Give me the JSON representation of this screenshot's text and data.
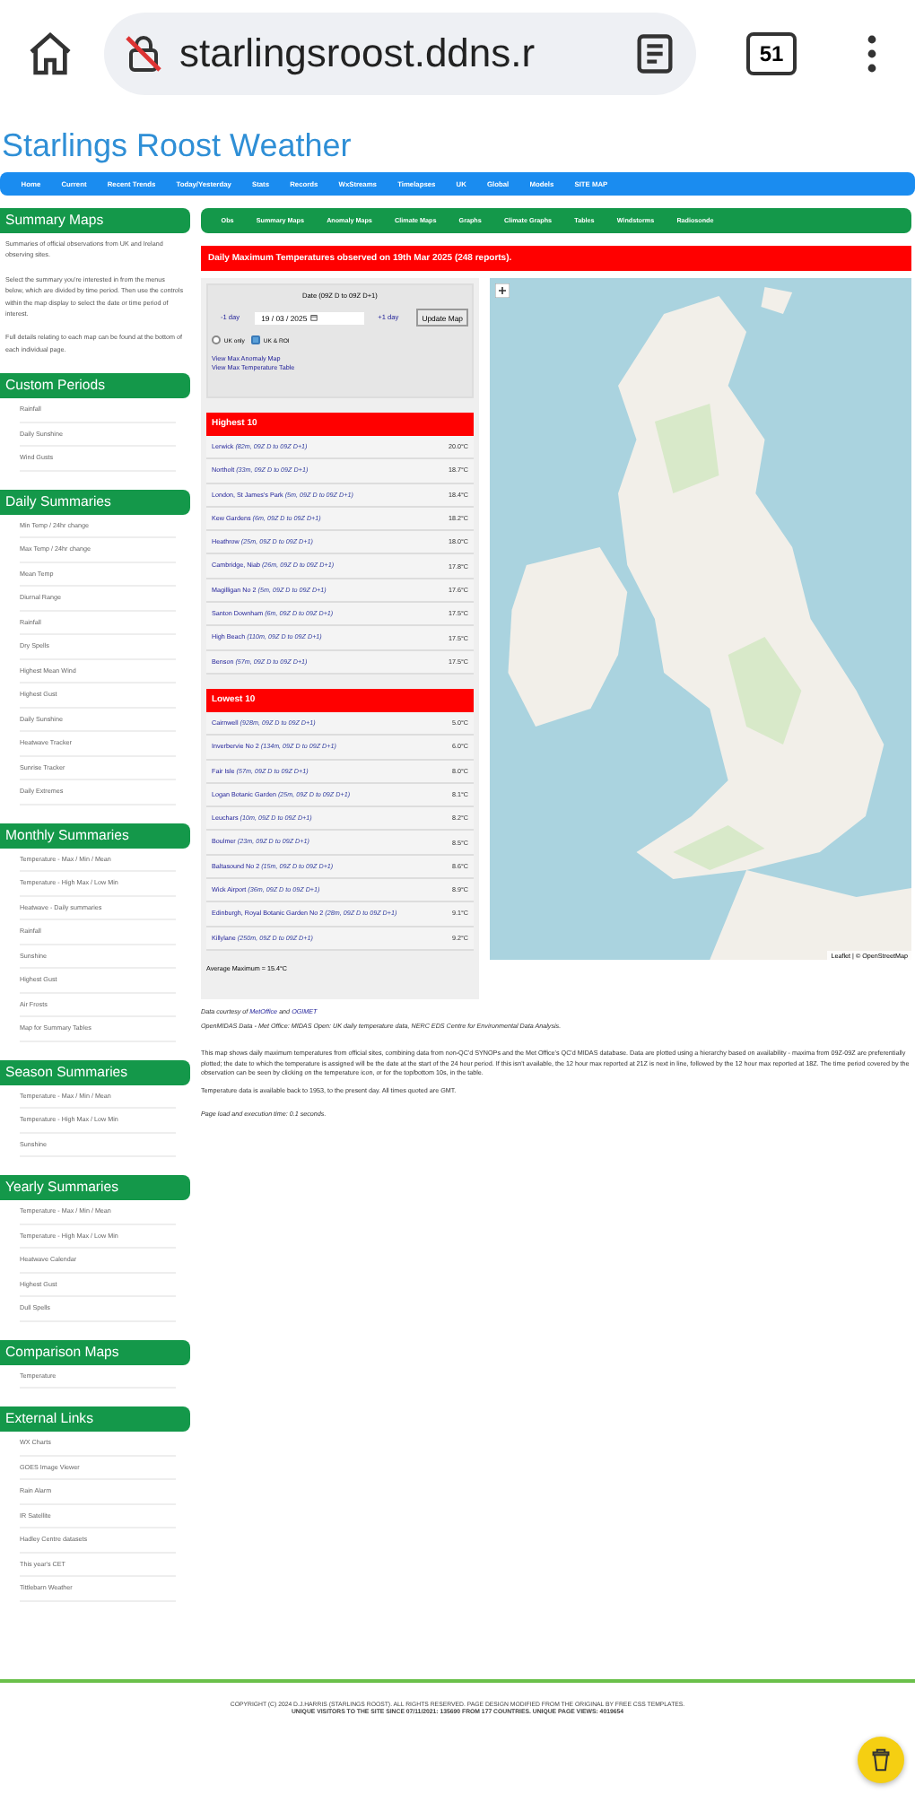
{
  "browser": {
    "url": "starlingsroost.ddns.r",
    "tab_count": "51"
  },
  "site_title": "Starlings Roost Weather",
  "nav": [
    "Home",
    "Current",
    "Recent Trends",
    "Today/Yesterday",
    "Stats",
    "Records",
    "WxStreams",
    "Timelapses",
    "UK",
    "Global",
    "Models",
    "SITE MAP"
  ],
  "sidebar": [
    {
      "title": "Summary Maps",
      "paragraphs": [
        "Summaries of official observations from UK and Ireland observing sites.",
        "Select the summary you're interested in from the menus below, which are divided by time period. Then use the controls within the map display to select the date or time period of interest.",
        "Full details relating to each map can be found at the bottom of each individual page."
      ]
    },
    {
      "title": "Custom Periods",
      "items": [
        "Rainfall",
        "Daily Sunshine",
        "Wind Gusts"
      ]
    },
    {
      "title": "Daily Summaries",
      "items": [
        "Min Temp / 24hr change",
        "Max Temp / 24hr change",
        "Mean Temp",
        "Diurnal Range",
        "Rainfall",
        "Dry Spells",
        "Highest Mean Wind",
        "Highest Gust",
        "Daily Sunshine",
        "Heatwave Tracker",
        "Sunrise Tracker",
        "Daily Extremes"
      ]
    },
    {
      "title": "Monthly Summaries",
      "items": [
        "Temperature - Max / Min / Mean",
        "Temperature - High Max / Low Min",
        "Heatwave - Daily summaries",
        "Rainfall",
        "Sunshine",
        "Highest Gust",
        "Air Frosts",
        "Map for Summary Tables"
      ]
    },
    {
      "title": "Season Summaries",
      "items": [
        "Temperature - Max / Min / Mean",
        "Temperature - High Max / Low Min",
        "Sunshine"
      ]
    },
    {
      "title": "Yearly Summaries",
      "items": [
        "Temperature - Max / Min / Mean",
        "Temperature - High Max / Low Min",
        "Heatwave Calendar",
        "Highest Gust",
        "Dull Spells"
      ]
    },
    {
      "title": "Comparison Maps",
      "items": [
        "Temperature"
      ]
    },
    {
      "title": "External Links",
      "items": [
        "WX Charts",
        "GOES Image Viewer",
        "Rain Alarm",
        "IR Satellite",
        "Hadley Centre datasets",
        "This year's CET",
        "Tittlebarn Weather"
      ]
    }
  ],
  "subnav": [
    "Obs",
    "Summary Maps",
    "Anomaly Maps",
    "Climate Maps",
    "Graphs",
    "Climate Graphs",
    "Tables",
    "Windstorms",
    "Radiosonde"
  ],
  "heading": "Daily Maximum Temperatures observed on 19th Mar 2025 (248 reports).",
  "controls": {
    "label": "Date (09Z D to 09Z D+1)",
    "prev": "-1 day",
    "date": "19 / 03 / 2025",
    "next": "+1 day",
    "update": "Update Map",
    "regions": [
      {
        "label": "UK only",
        "selected": false
      },
      {
        "label": "UK & ROI",
        "selected": true
      }
    ],
    "links": [
      "View Max Anomaly Map",
      "View Max Temperature Table"
    ]
  },
  "tables": [
    {
      "title": "Highest 10",
      "rows": [
        {
          "name": "Lerwick",
          "detail": "(82m, 09Z D to 09Z D+1)",
          "value": "20.0°C"
        },
        {
          "name": "Northolt",
          "detail": "(33m, 09Z D to 09Z D+1)",
          "value": "18.7°C"
        },
        {
          "name": "London, St James's Park",
          "detail": "(5m, 09Z D to 09Z D+1)",
          "value": "18.4°C"
        },
        {
          "name": "Kew Gardens",
          "detail": "(6m, 09Z D to 09Z D+1)",
          "value": "18.2°C"
        },
        {
          "name": "Heathrow",
          "detail": "(25m, 09Z D to 09Z D+1)",
          "value": "18.0°C"
        },
        {
          "name": "Cambridge, Niab",
          "detail": "(26m, 09Z D to 09Z D+1)",
          "value": "17.8°C"
        },
        {
          "name": "Magilligan No 2",
          "detail": "(5m, 09Z D to 09Z D+1)",
          "value": "17.6°C"
        },
        {
          "name": "Santon Downham",
          "detail": "(6m, 09Z D to 09Z D+1)",
          "value": "17.5°C"
        },
        {
          "name": "High Beach",
          "detail": "(110m, 09Z D to 09Z D+1)",
          "value": "17.5°C"
        },
        {
          "name": "Benson",
          "detail": "(57m, 09Z D to 09Z D+1)",
          "value": "17.5°C"
        }
      ]
    },
    {
      "title": "Lowest 10",
      "rows": [
        {
          "name": "Cairnwell",
          "detail": "(928m, 09Z D to 09Z D+1)",
          "value": "5.0°C"
        },
        {
          "name": "Inverbervie No 2",
          "detail": "(134m, 09Z D to 09Z D+1)",
          "value": "6.0°C"
        },
        {
          "name": "Fair Isle",
          "detail": "(57m, 09Z D to 09Z D+1)",
          "value": "8.0°C"
        },
        {
          "name": "Logan Botanic Garden",
          "detail": "(25m, 09Z D to 09Z D+1)",
          "value": "8.1°C"
        },
        {
          "name": "Leuchars",
          "detail": "(10m, 09Z D to 09Z D+1)",
          "value": "8.2°C"
        },
        {
          "name": "Boulmer",
          "detail": "(23m, 09Z D to 09Z D+1)",
          "value": "8.5°C"
        },
        {
          "name": "Baltasound No 2",
          "detail": "(15m, 09Z D to 09Z D+1)",
          "value": "8.6°C"
        },
        {
          "name": "Wick Airport",
          "detail": "(36m, 09Z D to 09Z D+1)",
          "value": "8.9°C"
        },
        {
          "name": "Edinburgh, Royal Botanic Garden No 2",
          "detail": "(28m, 09Z D to 09Z D+1)",
          "value": "9.1°C"
        },
        {
          "name": "Killylane",
          "detail": "(250m, 09Z D to 09Z D+1)",
          "value": "9.2°C"
        }
      ]
    }
  ],
  "average": "Average Maximum = 15.4°C",
  "map": {
    "kind": "picture",
    "attribution": "Leaflet | © OpenStreetMap"
  },
  "credits": {
    "prefix": "Data courtesy of",
    "link1": "MetOffice",
    "joiner": "and",
    "link2": "OGIMET",
    "source": "OpenMIDAS Data - Met Office: MIDAS Open: UK daily temperature data, NERC EDS Centre for Environmental Data Analysis."
  },
  "notes": [
    "This map shows daily maximum temperatures from official sites, combining data from non-QC'd SYNOPs and the Met Office's QC'd MIDAS database. Data are plotted using a hierarchy based on availability - maxima from 09Z-09Z are preferentially plotted; the date to which the temperature is assigned will be the date at the start of the 24 hour period. If this isn't available, the 12 hour max reported at 21Z is next in line, followed by the 12 hour max reported at 18Z. The time period covered by the observation can be seen by clicking on the temperature icon, or for the top/bottom 10s, in the table.",
    "Temperature data is available back to 1953, to the present day. All times quoted are GMT."
  ],
  "load_time": "Page load and execution time: 0.1 seconds.",
  "footer": [
    "COPYRIGHT (C) 2024 D.J.HARRIS (STARLINGS ROOST). ALL RIGHTS RESERVED. PAGE DESIGN MODIFIED FROM THE ORIGINAL BY FREE CSS TEMPLATES.",
    "UNIQUE VISITORS TO THE SITE SINCE 07/11/2021: 135690 FROM 177 COUNTRIES. UNIQUE PAGE VIEWS: 4019654"
  ]
}
